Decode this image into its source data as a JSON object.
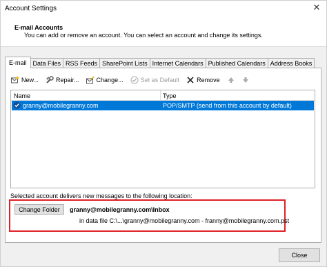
{
  "window": {
    "title": "Account Settings",
    "close_glyph": "✕"
  },
  "header": {
    "title": "E-mail Accounts",
    "description": "You can add or remove an account. You can select an account and change its settings."
  },
  "tabs": [
    {
      "label": "E-mail",
      "active": true
    },
    {
      "label": "Data Files"
    },
    {
      "label": "RSS Feeds"
    },
    {
      "label": "SharePoint Lists"
    },
    {
      "label": "Internet Calendars"
    },
    {
      "label": "Published Calendars"
    },
    {
      "label": "Address Books"
    }
  ],
  "toolbar": {
    "new_label": "New...",
    "repair_label": "Repair...",
    "change_label": "Change...",
    "set_default_label": "Set as Default",
    "remove_label": "Remove"
  },
  "accounts_list": {
    "col_name": "Name",
    "col_type": "Type",
    "rows": [
      {
        "name": "granny@mobilegranny.com",
        "type": "POP/SMTP (send from this account by default)",
        "selected": true
      }
    ]
  },
  "delivery": {
    "label": "Selected account delivers new messages to the following location:",
    "change_folder_label": "Change Folder",
    "folder_path": "granny@mobilegranny.com\\Inbox",
    "data_file": "in data file C:\\...\\granny@mobilegranny.com - franny@mobilegranny.com.pst"
  },
  "footer": {
    "close_label": "Close"
  },
  "colors": {
    "selection": "#0078d7",
    "highlight_box": "#e01f26"
  }
}
